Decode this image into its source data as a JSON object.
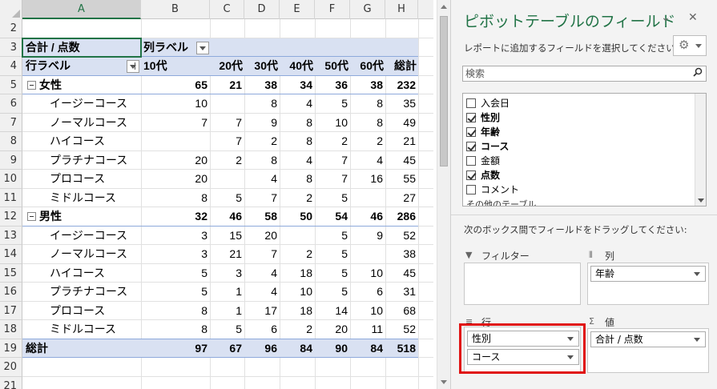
{
  "sheet": {
    "columns": [
      "A",
      "B",
      "C",
      "D",
      "E",
      "F",
      "G",
      "H"
    ],
    "rows": [
      "2",
      "3",
      "4",
      "5",
      "6",
      "7",
      "8",
      "9",
      "10",
      "11",
      "12",
      "13",
      "14",
      "15",
      "16",
      "17",
      "18",
      "19",
      "20",
      "21"
    ],
    "selected_column": "A",
    "pivot": {
      "value_caption": "合計 / 点数",
      "column_labels": "列ラベル",
      "row_labels": "行ラベル",
      "col_headers": [
        "10代",
        "20代",
        "30代",
        "40代",
        "50代",
        "60代",
        "総計"
      ],
      "groups": [
        {
          "name": "女性",
          "totals": [
            "65",
            "21",
            "38",
            "34",
            "36",
            "38",
            "232"
          ],
          "items": [
            {
              "label": "イージーコース",
              "values": [
                "10",
                "",
                "8",
                "4",
                "5",
                "8",
                "35"
              ]
            },
            {
              "label": "ノーマルコース",
              "values": [
                "7",
                "7",
                "9",
                "8",
                "10",
                "8",
                "49"
              ]
            },
            {
              "label": "ハイコース",
              "values": [
                "",
                "7",
                "2",
                "8",
                "2",
                "2",
                "21"
              ]
            },
            {
              "label": "プラチナコース",
              "values": [
                "20",
                "2",
                "8",
                "4",
                "7",
                "4",
                "45"
              ]
            },
            {
              "label": "プロコース",
              "values": [
                "20",
                "",
                "4",
                "8",
                "7",
                "16",
                "55"
              ]
            },
            {
              "label": "ミドルコース",
              "values": [
                "8",
                "5",
                "7",
                "2",
                "5",
                "",
                "27"
              ]
            }
          ]
        },
        {
          "name": "男性",
          "totals": [
            "32",
            "46",
            "58",
            "50",
            "54",
            "46",
            "286"
          ],
          "items": [
            {
              "label": "イージーコース",
              "values": [
                "3",
                "15",
                "20",
                "",
                "5",
                "9",
                "52"
              ]
            },
            {
              "label": "ノーマルコース",
              "values": [
                "3",
                "21",
                "7",
                "2",
                "5",
                "",
                "38"
              ]
            },
            {
              "label": "ハイコース",
              "values": [
                "5",
                "3",
                "4",
                "18",
                "5",
                "10",
                "45"
              ]
            },
            {
              "label": "プラチナコース",
              "values": [
                "5",
                "1",
                "4",
                "10",
                "5",
                "6",
                "31"
              ]
            },
            {
              "label": "プロコース",
              "values": [
                "8",
                "1",
                "17",
                "18",
                "14",
                "10",
                "68"
              ]
            },
            {
              "label": "ミドルコース",
              "values": [
                "8",
                "5",
                "6",
                "2",
                "20",
                "11",
                "52"
              ]
            }
          ]
        }
      ],
      "grand_total_label": "総計",
      "grand_totals": [
        "97",
        "67",
        "96",
        "84",
        "90",
        "84",
        "518"
      ]
    }
  },
  "pane": {
    "title": "ピボットテーブルのフィールド",
    "choose_label": "レポートに追加するフィールドを選択してください:",
    "search_placeholder": "検索",
    "fields": [
      {
        "label": "入会日",
        "checked": false
      },
      {
        "label": "性別",
        "checked": true
      },
      {
        "label": "年齢",
        "checked": true
      },
      {
        "label": "コース",
        "checked": true
      },
      {
        "label": "金額",
        "checked": false
      },
      {
        "label": "点数",
        "checked": true
      },
      {
        "label": "コメント",
        "checked": false
      }
    ],
    "more_label": "その他のテーブル...",
    "drag_label": "次のボックス間でフィールドをドラッグしてください:",
    "areas": {
      "filter": {
        "label": "フィルター",
        "icon": "filter-icon",
        "chips": []
      },
      "columns": {
        "label": "列",
        "icon": "columns-icon",
        "chips": [
          "年齢"
        ]
      },
      "rows": {
        "label": "行",
        "icon": "rows-icon",
        "chips": [
          "性別",
          "コース"
        ]
      },
      "values": {
        "label": "値",
        "icon": "sigma-icon",
        "chips": [
          "合計 / 点数"
        ]
      }
    },
    "highlight_color": "#e01010",
    "accent_color": "#217346"
  }
}
